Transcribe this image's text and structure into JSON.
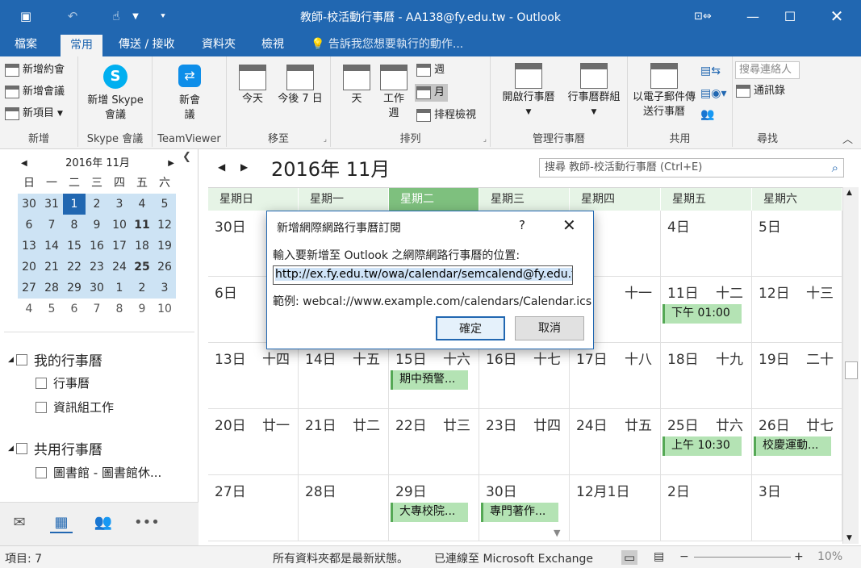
{
  "window": {
    "title": "教師-校活動行事曆 - AA138@fy.edu.tw - Outlook"
  },
  "tabs": [
    {
      "label": "檔案"
    },
    {
      "label": "常用"
    },
    {
      "label": "傳送 / 接收"
    },
    {
      "label": "資料夾"
    },
    {
      "label": "檢視"
    }
  ],
  "tell_me": "告訴我您想要執行的動作...",
  "ribbon": {
    "new_group": {
      "new_appointment": "新增約會",
      "new_meeting": "新增會議",
      "new_items": "新項目",
      "label": "新增"
    },
    "skype_group": {
      "btn": "新增 Skype 會議",
      "label": "Skype 會議"
    },
    "teamviewer_group": {
      "btn": "新會議",
      "label": "TeamViewer"
    },
    "goto_group": {
      "today": "今天",
      "next7": "今後 7 日",
      "label": "移至"
    },
    "arrange_group": {
      "day": "天",
      "work_week": "工作週",
      "week": "週",
      "month": "月",
      "schedule": "排程檢視",
      "label": "排列"
    },
    "manage_group": {
      "open_calendar": "開啟行事曆",
      "calendar_groups": "行事曆群組",
      "label": "管理行事曆"
    },
    "share_group": {
      "email_calendar": "以電子郵件傳送行事曆",
      "label": "共用"
    },
    "find_group": {
      "search_people_placeholder": "搜尋連絡人",
      "address_book": "通訊錄",
      "label": "尋找"
    }
  },
  "mini_calendar": {
    "month_label": "2016年 11月",
    "weekdays": [
      "日",
      "一",
      "二",
      "三",
      "四",
      "五",
      "六"
    ],
    "weeks": [
      [
        "30",
        "31",
        "1",
        "2",
        "3",
        "4",
        "5"
      ],
      [
        "6",
        "7",
        "8",
        "9",
        "10",
        "11",
        "12"
      ],
      [
        "13",
        "14",
        "15",
        "16",
        "17",
        "18",
        "19"
      ],
      [
        "20",
        "21",
        "22",
        "23",
        "24",
        "25",
        "26"
      ],
      [
        "27",
        "28",
        "29",
        "30",
        "1",
        "2",
        "3"
      ],
      [
        "4",
        "5",
        "6",
        "7",
        "8",
        "9",
        "10"
      ]
    ]
  },
  "folders": {
    "my_calendars": "我的行事曆",
    "my_items": [
      "行事曆",
      "資訊組工作"
    ],
    "shared_calendars": "共用行事曆",
    "shared_items": [
      "圖書館 - 圖書館休..."
    ]
  },
  "calendar": {
    "title": "2016年 11月",
    "search_placeholder": "搜尋 教師-校活動行事曆 (Ctrl+E)",
    "day_headers": [
      "星期日",
      "星期一",
      "星期二",
      "星期三",
      "星期四",
      "星期五",
      "星期六"
    ],
    "weeks": [
      [
        {
          "d": "30日",
          "l": ""
        },
        {
          "d": "",
          "l": ""
        },
        {
          "d": "",
          "l": ""
        },
        {
          "d": "",
          "l": ""
        },
        {
          "d": "",
          "l": ""
        },
        {
          "d": "4日",
          "l": ""
        },
        {
          "d": "5日",
          "l": ""
        }
      ],
      [
        {
          "d": "6日",
          "l": ""
        },
        {
          "d": "",
          "l": ""
        },
        {
          "d": "",
          "l": ""
        },
        {
          "d": "",
          "l": ""
        },
        {
          "d": "",
          "l": "十一"
        },
        {
          "d": "11日",
          "l": "十二"
        },
        {
          "d": "12日",
          "l": "十三"
        }
      ],
      [
        {
          "d": "13日",
          "l": "十四"
        },
        {
          "d": "14日",
          "l": "十五"
        },
        {
          "d": "15日",
          "l": "十六"
        },
        {
          "d": "16日",
          "l": "十七"
        },
        {
          "d": "17日",
          "l": "十八"
        },
        {
          "d": "18日",
          "l": "十九"
        },
        {
          "d": "19日",
          "l": "二十"
        }
      ],
      [
        {
          "d": "20日",
          "l": "廿一"
        },
        {
          "d": "21日",
          "l": "廿二"
        },
        {
          "d": "22日",
          "l": "廿三"
        },
        {
          "d": "23日",
          "l": "廿四"
        },
        {
          "d": "24日",
          "l": "廿五"
        },
        {
          "d": "25日",
          "l": "廿六"
        },
        {
          "d": "26日",
          "l": "廿七"
        }
      ],
      [
        {
          "d": "27日",
          "l": ""
        },
        {
          "d": "28日",
          "l": ""
        },
        {
          "d": "29日",
          "l": ""
        },
        {
          "d": "30日",
          "l": ""
        },
        {
          "d": "12月1日",
          "l": ""
        },
        {
          "d": "2日",
          "l": ""
        },
        {
          "d": "3日",
          "l": ""
        }
      ]
    ],
    "events": [
      {
        "week": 1,
        "day": 5,
        "text": "下午 01:00"
      },
      {
        "week": 2,
        "day": 2,
        "text": "期中預警..."
      },
      {
        "week": 3,
        "day": 5,
        "text": "上午 10:30"
      },
      {
        "week": 3,
        "day": 6,
        "text": "校慶運動..."
      },
      {
        "week": 4,
        "day": 2,
        "text": "大專校院..."
      },
      {
        "week": 4,
        "day": 3,
        "text": "專門著作..."
      }
    ]
  },
  "dialog": {
    "title": "新增網際網路行事曆訂閱",
    "help": "?",
    "prompt": "輸入要新增至 Outlook 之網際網路行事曆的位置:",
    "url_value": "http://ex.fy.edu.tw/owa/calendar/semcalend@fy.edu.t",
    "example": "範例: webcal://www.example.com/calendars/Calendar.ics",
    "ok": "確定",
    "cancel": "取消"
  },
  "status": {
    "items": "項目: 7",
    "folders_state": "所有資料夾都是最新狀態。",
    "connection": "已連線至 Microsoft Exchange",
    "zoom": "10%"
  }
}
